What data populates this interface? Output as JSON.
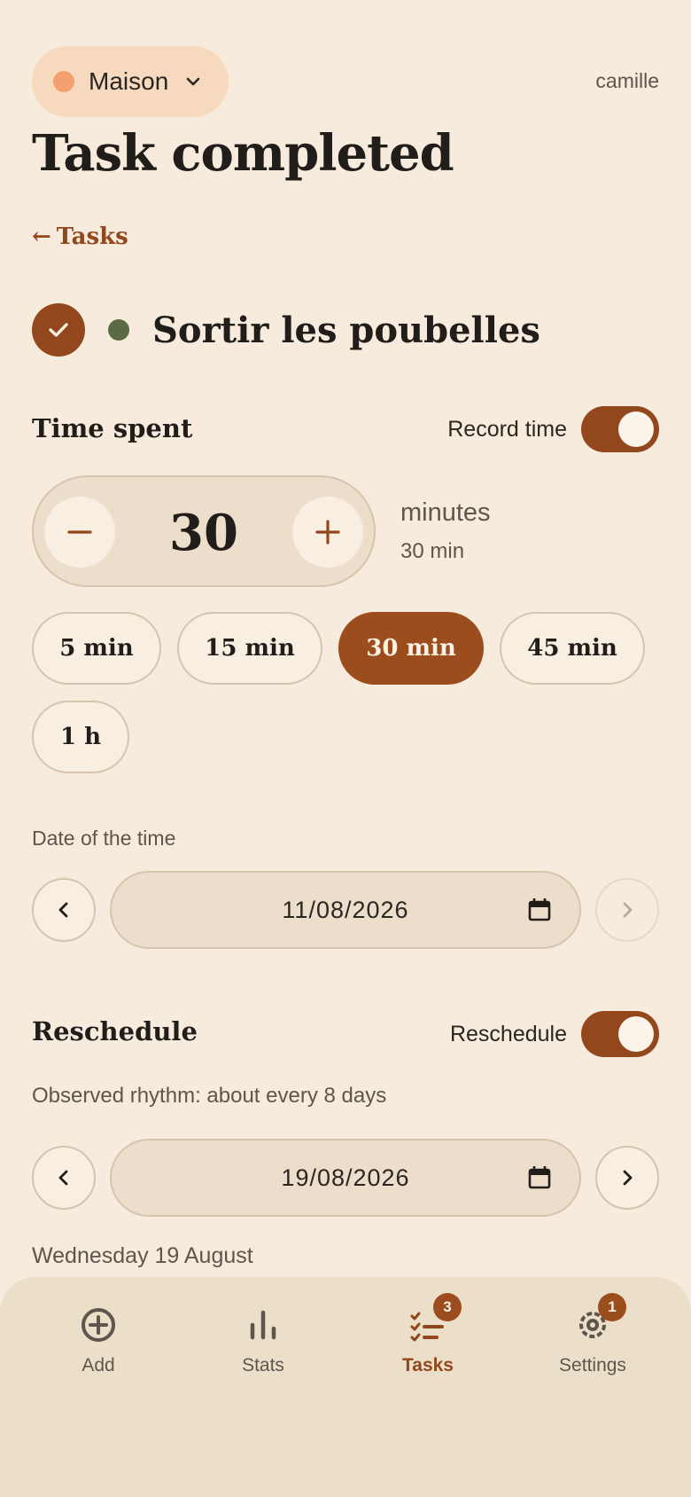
{
  "header": {
    "household": "Maison",
    "user": "camille",
    "title": "Task completed",
    "back_label": "Tasks"
  },
  "task": {
    "name": "Sortir les poubelles"
  },
  "time_spent": {
    "title": "Time spent",
    "toggle_label": "Record time",
    "toggle_on": true,
    "value": "30",
    "unit": "minutes",
    "summary": "30 min",
    "presets": [
      "5 min",
      "15 min",
      "30 min",
      "45 min",
      "1 h"
    ],
    "selected_preset": "30 min",
    "date_label": "Date of the time",
    "date": "11/08/2026"
  },
  "reschedule": {
    "title": "Reschedule",
    "toggle_label": "Reschedule",
    "toggle_on": true,
    "observed": "Observed rhythm: about every 8 days",
    "date": "19/08/2026",
    "weekday": "Wednesday 19 August"
  },
  "nav": {
    "items": [
      {
        "label": "Add",
        "icon": "add-circle-icon"
      },
      {
        "label": "Stats",
        "icon": "stats-icon"
      },
      {
        "label": "Tasks",
        "icon": "tasks-icon",
        "badge": "3",
        "active": true
      },
      {
        "label": "Settings",
        "icon": "settings-icon",
        "badge": "1"
      }
    ]
  },
  "colors": {
    "accent": "#93471c",
    "background": "#f6ebdc",
    "household_dot": "#f4a06e",
    "task_dot": "#5b6a45"
  }
}
